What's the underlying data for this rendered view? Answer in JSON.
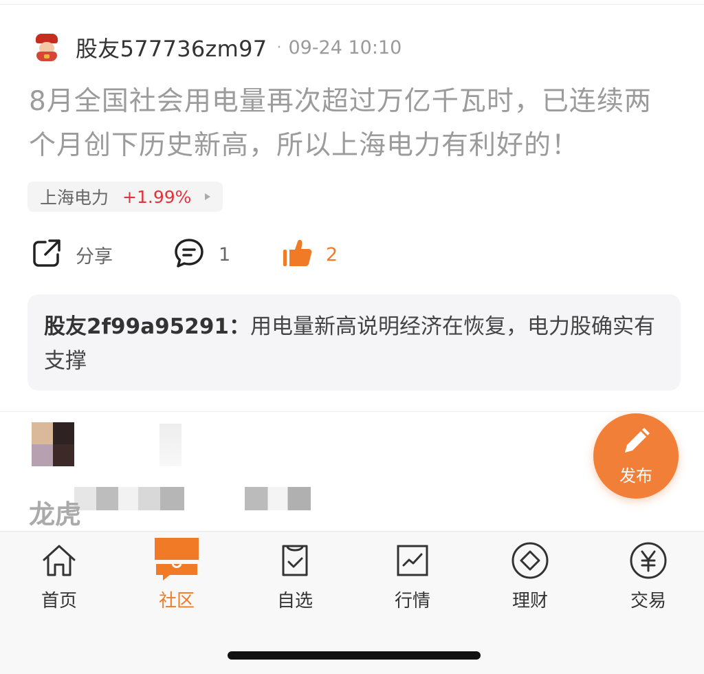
{
  "post": {
    "username": "股友577736zm97",
    "separator": "·",
    "time": "09-24 10:10",
    "content": "8月全国社会用电量再次超过万亿千瓦时，已连续两个月创下历史新高，所以上海电力有利好的！",
    "stock": {
      "name": "上海电力",
      "change": "+1.99%"
    }
  },
  "actions": {
    "share_label": "分享",
    "comment_count": "1",
    "like_count": "2"
  },
  "reply": {
    "username": "股友2f99a95291：",
    "text": "用电量新高说明经济在恢复，电力股确实有支撑"
  },
  "next_post": {
    "partial_text": "龙虎"
  },
  "fab": {
    "label": "发布"
  },
  "tabs": [
    {
      "label": "首页",
      "icon": "home-icon"
    },
    {
      "label": "社区",
      "icon": "community-icon",
      "active": true
    },
    {
      "label": "自选",
      "icon": "watchlist-icon"
    },
    {
      "label": "行情",
      "icon": "market-chart-icon"
    },
    {
      "label": "理财",
      "icon": "wealth-icon"
    },
    {
      "label": "交易",
      "icon": "yuan-icon"
    }
  ],
  "colors": {
    "accent": "#f07a25",
    "rise": "#e1343a",
    "fab": "#f27f38"
  }
}
